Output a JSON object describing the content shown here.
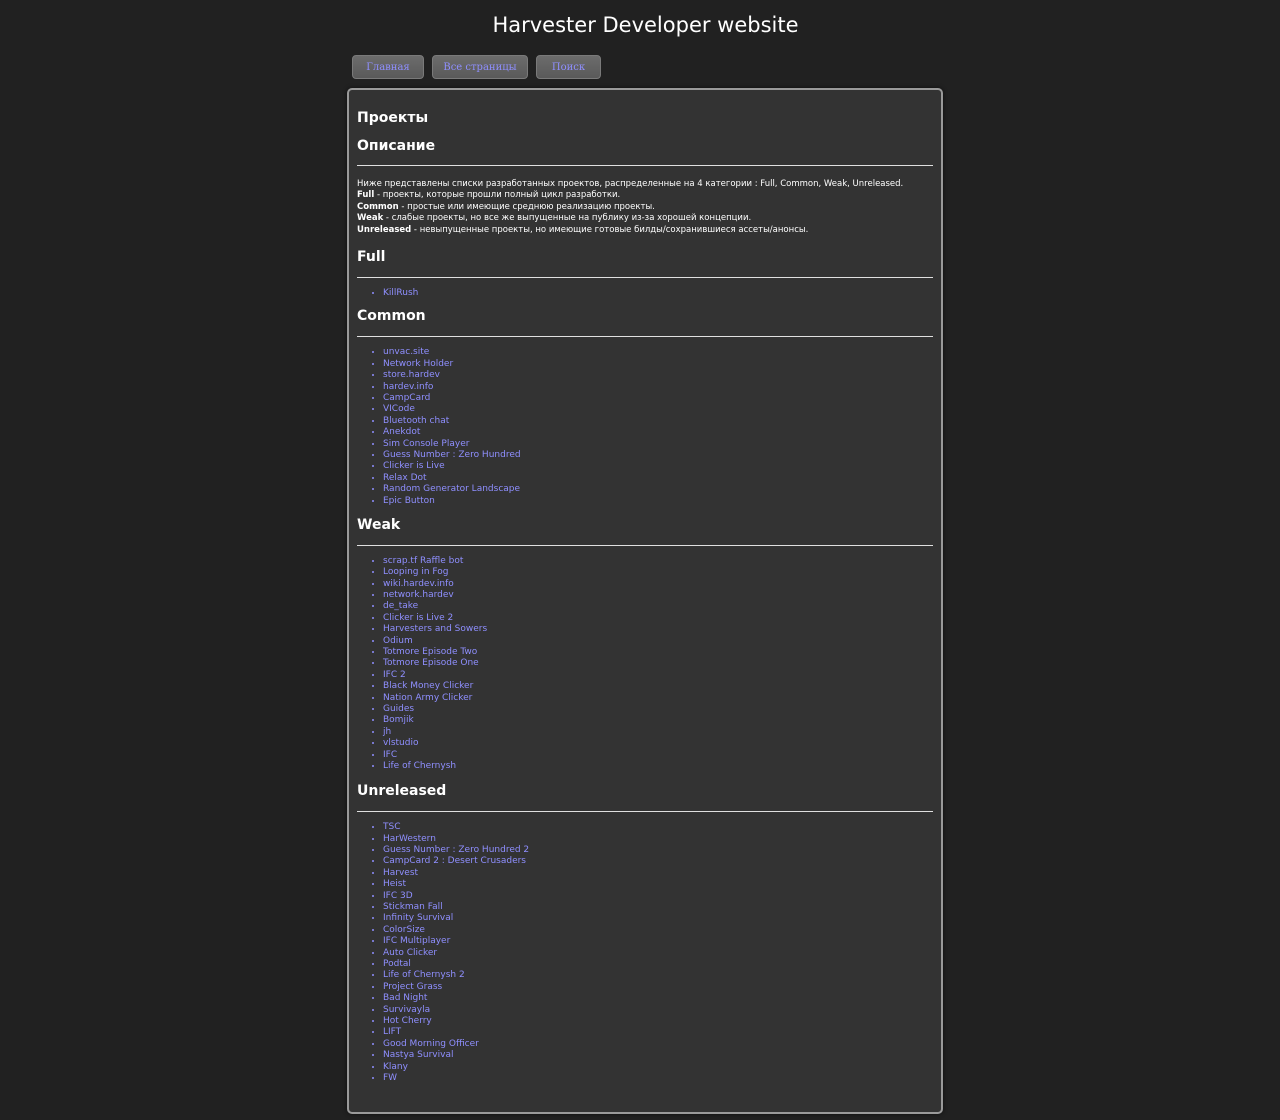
{
  "site": {
    "title": "Harvester Developer website"
  },
  "nav": {
    "home": "Главная",
    "all_pages": "Все страницы",
    "search": "Поиск"
  },
  "page": {
    "title": "Проекты",
    "description": {
      "heading": "Описание",
      "intro": "Ниже представлены списки разработанных проектов, распределенные на 4 категории : Full, Common, Weak, Unreleased.",
      "full_term": "Full",
      "full_text": " - проекты, которые прошли полный цикл разработки.",
      "common_term": "Common",
      "common_text": " - простые или имеющие среднюю реализацию проекты.",
      "weak_term": "Weak",
      "weak_text": " - слабые проекты, но все же выпущенные на публику из-за хорошей концепции.",
      "unreleased_term": "Unreleased",
      "unreleased_text": " - невыпущенные проекты, но имеющие готовые билды/сохранившиеся ассеты/анонсы."
    },
    "sections": {
      "full": {
        "heading": "Full",
        "items": [
          "KillRush"
        ]
      },
      "common": {
        "heading": "Common",
        "items": [
          "unvac.site",
          "Network Holder",
          "store.hardev",
          "hardev.info",
          "CampCard",
          "VICode",
          "Bluetooth chat",
          "Anekdot",
          "Sim Console Player",
          "Guess Number : Zero Hundred",
          "Clicker is Live",
          "Relax Dot",
          "Random Generator Landscape",
          "Epic Button"
        ]
      },
      "weak": {
        "heading": "Weak",
        "items": [
          "scrap.tf Raffle bot",
          "Looping in Fog",
          "wiki.hardev.info",
          "network.hardev",
          "de_take",
          "Clicker is Live 2",
          "Harvesters and Sowers",
          "Odium",
          "Totmore Episode Two",
          "Totmore Episode One",
          "IFC 2",
          "Black Money Clicker",
          "Nation Army Clicker",
          "Guides",
          "Bomjik",
          "jh",
          "vlstudio",
          "IFC",
          "Life of Chernysh"
        ]
      },
      "unreleased": {
        "heading": "Unreleased",
        "items": [
          "TSC",
          "HarWestern",
          "Guess Number : Zero Hundred 2",
          "CampCard 2 : Desert Crusaders",
          "Harvest",
          "Heist",
          "IFC 3D",
          "Stickman Fall",
          "Infinity Survival",
          "ColorSize",
          "IFC Multiplayer",
          "Auto Clicker",
          "Podtal",
          "Life of Chernysh 2",
          "Project Grass",
          "Bad Night",
          "Survivayla",
          "Hot Cherry",
          "LIFT",
          "Good Morning Officer",
          "Nastya Survival",
          "Klany",
          "FW"
        ]
      }
    }
  },
  "colors": {
    "background": "#212121",
    "panel": "#333333",
    "link": "#8f8fff",
    "text": "#ffffff"
  }
}
